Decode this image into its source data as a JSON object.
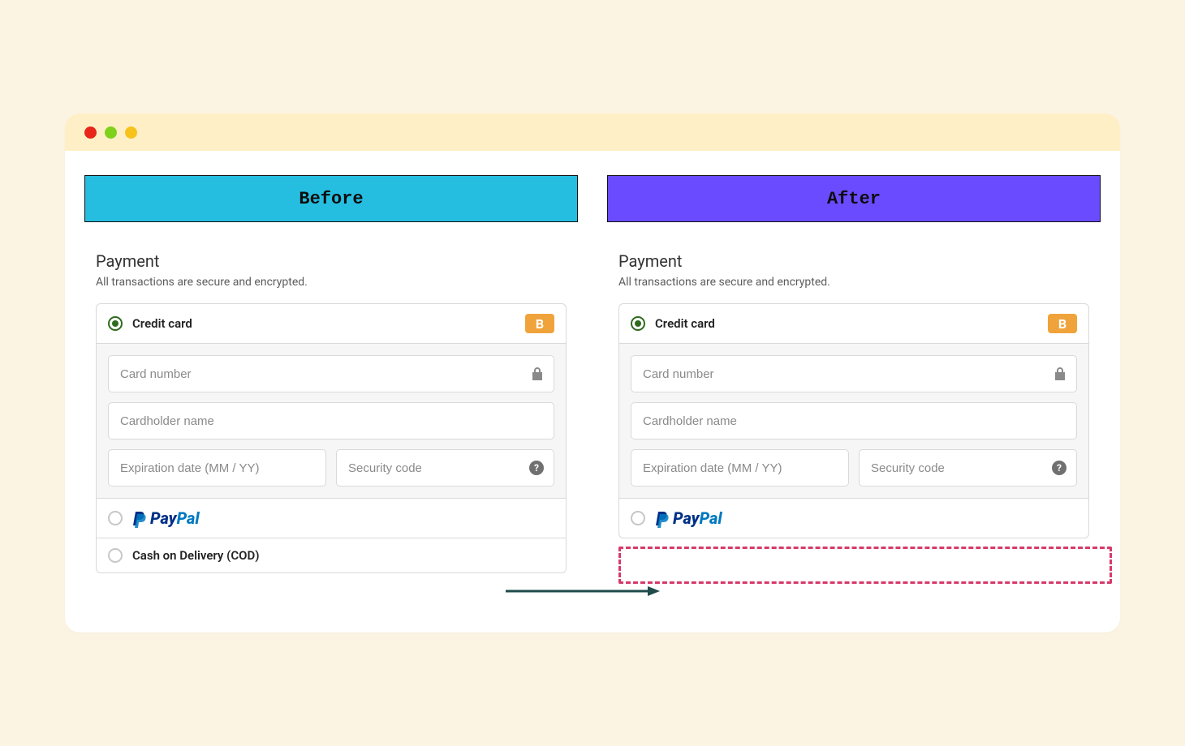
{
  "banners": {
    "before": "Before",
    "after": "After"
  },
  "section": {
    "title": "Payment",
    "subtitle": "All transactions are secure and encrypted."
  },
  "options": {
    "credit_card": "Credit card",
    "paypal_pay": "Pay",
    "paypal_pal": "Pal",
    "cod": "Cash on Delivery (COD)",
    "badge": "B"
  },
  "fields": {
    "card_number": "Card number",
    "cardholder": "Cardholder name",
    "expiry": "Expiration date (MM / YY)",
    "cvv": "Security code"
  }
}
